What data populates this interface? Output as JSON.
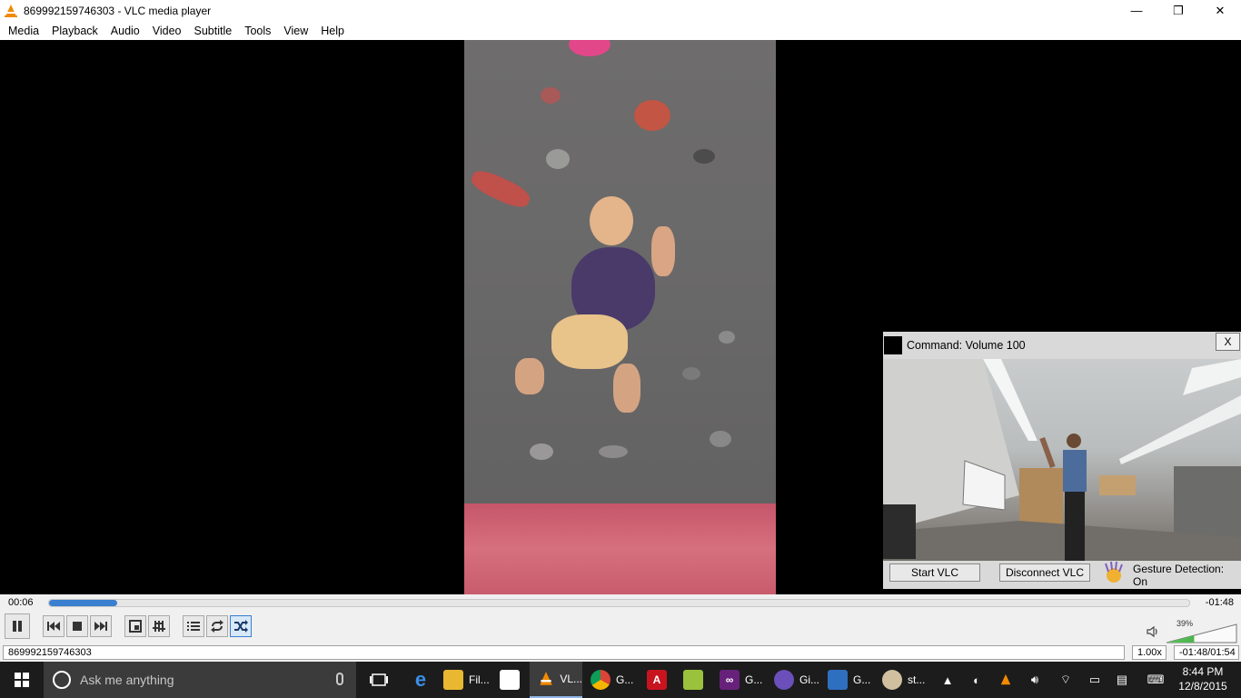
{
  "window": {
    "title": "869992159746303 - VLC media player",
    "minimize_glyph": "—",
    "maximize_glyph": "❐",
    "close_glyph": "✕"
  },
  "menu": [
    "Media",
    "Playback",
    "Audio",
    "Video",
    "Subtitle",
    "Tools",
    "View",
    "Help"
  ],
  "gesture_panel": {
    "command": "Command: Volume 100",
    "close_label": "X",
    "start_button": "Start VLC",
    "disconnect_button": "Disconnect VLC",
    "detection_status": "Gesture Detection: On"
  },
  "playback": {
    "elapsed": "00:06",
    "remaining": "-01:48",
    "progress": 0.06,
    "volume_percent": "39%",
    "volume_level": 0.39
  },
  "controls": {
    "pause": "pause-icon",
    "previous": "skip-back-icon",
    "stop": "stop-icon",
    "next": "skip-forward-icon",
    "fullscreen": "fullscreen-icon",
    "extended": "equalizer-icon",
    "playlist": "playlist-icon",
    "loop": "loop-icon",
    "random": "shuffle-icon",
    "random_active": true
  },
  "status": {
    "filename": "869992159746303",
    "speed": "1.00x",
    "time": "-01:48/01:54"
  },
  "taskbar": {
    "search_placeholder": "Ask me anything",
    "apps": [
      {
        "label": "Fil...",
        "icon": "file-explorer-icon"
      },
      {
        "label": "VL...",
        "icon": "vlc-icon"
      },
      {
        "label": "G...",
        "icon": "chrome-icon"
      },
      {
        "label": "G...",
        "icon": "visual-studio-icon"
      },
      {
        "label": "Gi...",
        "icon": "github-icon"
      },
      {
        "label": "G...",
        "icon": "window-app-icon"
      },
      {
        "label": "st...",
        "icon": "paint-icon"
      }
    ],
    "clock_time": "8:44 PM",
    "clock_date": "12/8/2015"
  },
  "colors": {
    "accent": "#3a7fd0",
    "vlc_orange": "#f08a00",
    "taskbar": "#1c1c1c"
  }
}
